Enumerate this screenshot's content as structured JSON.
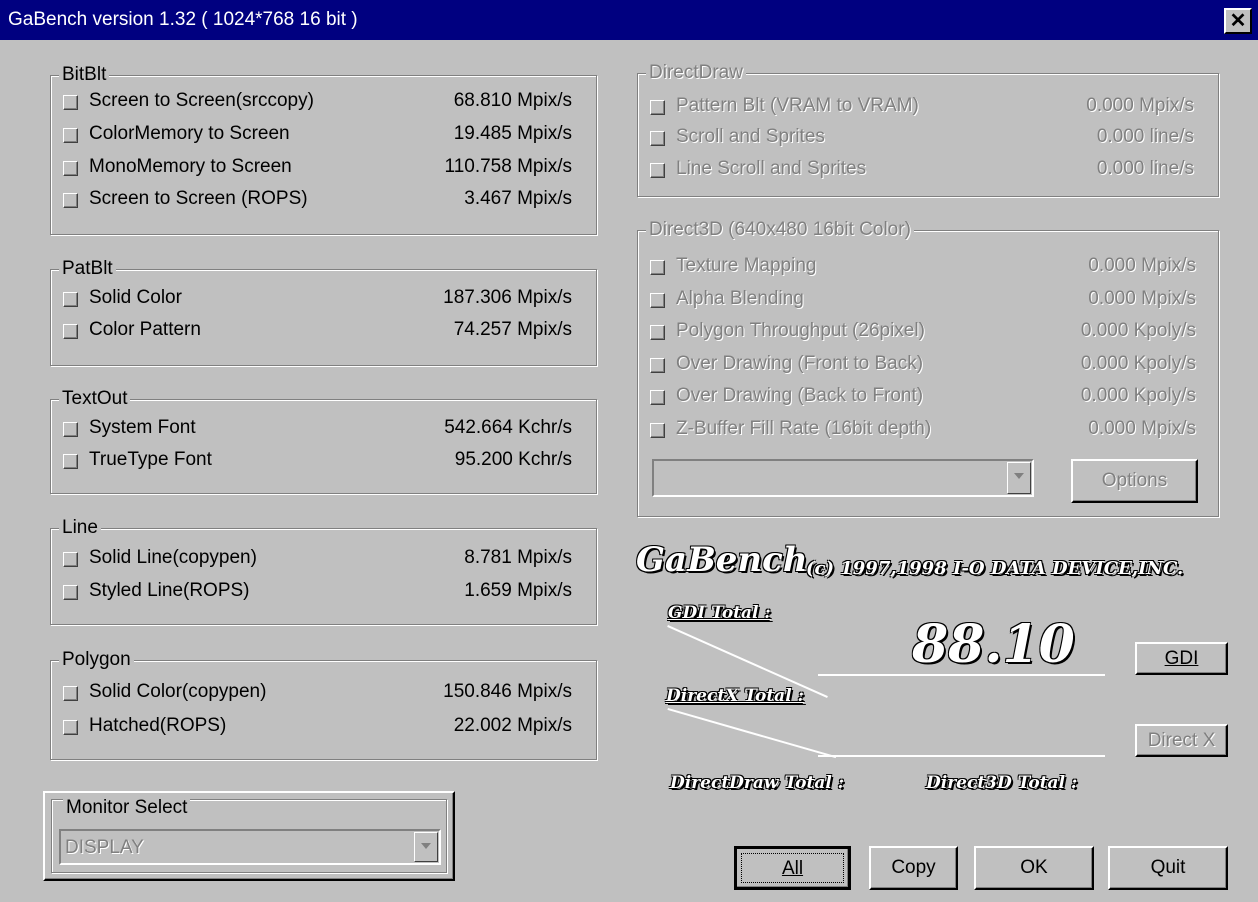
{
  "window": {
    "title": "GaBench version 1.32 ( 1024*768 16 bit )",
    "close_label": "✕"
  },
  "bitblt": {
    "title": "BitBlt",
    "rows": [
      {
        "label": "Screen to Screen(srccopy)",
        "value": "68.810 Mpix/s"
      },
      {
        "label": "ColorMemory to Screen",
        "value": "19.485 Mpix/s"
      },
      {
        "label": "MonoMemory to Screen",
        "value": "110.758 Mpix/s"
      },
      {
        "label": "Screen to Screen (ROPS)",
        "value": "3.467 Mpix/s"
      }
    ]
  },
  "patblt": {
    "title": "PatBlt",
    "rows": [
      {
        "label": "Solid Color",
        "value": "187.306 Mpix/s"
      },
      {
        "label": "Color Pattern",
        "value": "74.257 Mpix/s"
      }
    ]
  },
  "textout": {
    "title": "TextOut",
    "rows": [
      {
        "label": "System Font",
        "value": "542.664 Kchr/s"
      },
      {
        "label": "TrueType Font",
        "value": "95.200 Kchr/s"
      }
    ]
  },
  "line": {
    "title": "Line",
    "rows": [
      {
        "label": "Solid Line(copypen)",
        "value": "8.781 Mpix/s"
      },
      {
        "label": "Styled Line(ROPS)",
        "value": "1.659 Mpix/s"
      }
    ]
  },
  "polygon": {
    "title": "Polygon",
    "rows": [
      {
        "label": "Solid Color(copypen)",
        "value": "150.846 Mpix/s"
      },
      {
        "label": "Hatched(ROPS)",
        "value": "22.002 Mpix/s"
      }
    ]
  },
  "monitor": {
    "title": "Monitor Select",
    "selected": "DISPLAY"
  },
  "directdraw": {
    "title": "DirectDraw",
    "rows": [
      {
        "label": "Pattern Blt (VRAM to VRAM)",
        "value": "0.000 Mpix/s"
      },
      {
        "label": "Scroll and Sprites",
        "value": "0.000 line/s"
      },
      {
        "label": "Line Scroll and Sprites",
        "value": "0.000 line/s"
      }
    ]
  },
  "direct3d": {
    "title": "Direct3D (640x480 16bit Color)",
    "rows": [
      {
        "label": "Texture Mapping",
        "value": "0.000 Mpix/s"
      },
      {
        "label": "Alpha Blending",
        "value": "0.000 Mpix/s"
      },
      {
        "label": "Polygon Throughput (26pixel)",
        "value": "0.000 Kpoly/s"
      },
      {
        "label": "Over Drawing (Front to Back)",
        "value": "0.000 Kpoly/s"
      },
      {
        "label": "Over Drawing (Back to Front)",
        "value": "0.000 Kpoly/s"
      },
      {
        "label": "Z-Buffer Fill Rate (16bit depth)",
        "value": "0.000 Mpix/s"
      }
    ],
    "device_selected": "",
    "options_label": "Options"
  },
  "brand": {
    "name": "GaBench",
    "copyright": "(c) 1997,1998 I-O DATA DEVICE,INC."
  },
  "totals": {
    "gdi_label": "GDI Total :",
    "gdi_value": "88.10",
    "directx_label": "DirectX Total :",
    "directdraw_label": "DirectDraw Total :",
    "direct3d_label": "Direct3D Total :"
  },
  "buttons": {
    "gdi": "GDI",
    "directx": "Direct X",
    "all": "All",
    "copy": "Copy",
    "ok": "OK",
    "quit": "Quit"
  }
}
